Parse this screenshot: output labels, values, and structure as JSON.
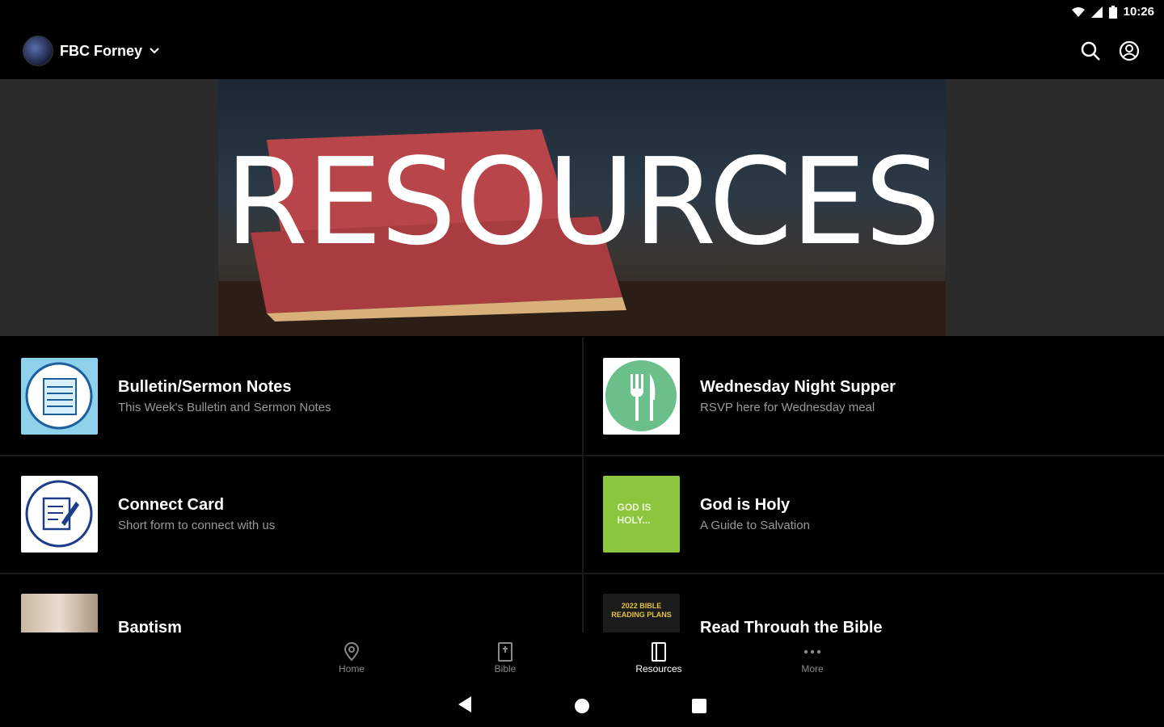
{
  "status": {
    "time": "10:26"
  },
  "header": {
    "org_name": "FBC Forney"
  },
  "hero": {
    "title": "RESOURCES"
  },
  "resources": [
    {
      "title": "Bulletin/Sermon Notes",
      "subtitle": "This Week's Bulletin and Sermon Notes"
    },
    {
      "title": "Wednesday Night Supper",
      "subtitle": "RSVP here for Wednesday meal"
    },
    {
      "title": "Connect Card",
      "subtitle": "Short form to connect with us"
    },
    {
      "title": "God is Holy",
      "subtitle": "A Guide to Salvation",
      "thumb_text": "GOD IS HOLY..."
    },
    {
      "title": "Baptism",
      "subtitle": ""
    },
    {
      "title": "Read Through the Bible",
      "subtitle": "",
      "thumb_text": "2022 BIBLE READING PLANS"
    }
  ],
  "nav": {
    "items": [
      {
        "label": "Home"
      },
      {
        "label": "Bible"
      },
      {
        "label": "Resources"
      },
      {
        "label": "More"
      }
    ],
    "active_index": 2
  },
  "colors": {
    "background": "#000000",
    "hero_bg": "#2b2b2b",
    "fork_green": "#6bbf8a",
    "holy_green": "#8cc63f",
    "muted_text": "#999999"
  }
}
